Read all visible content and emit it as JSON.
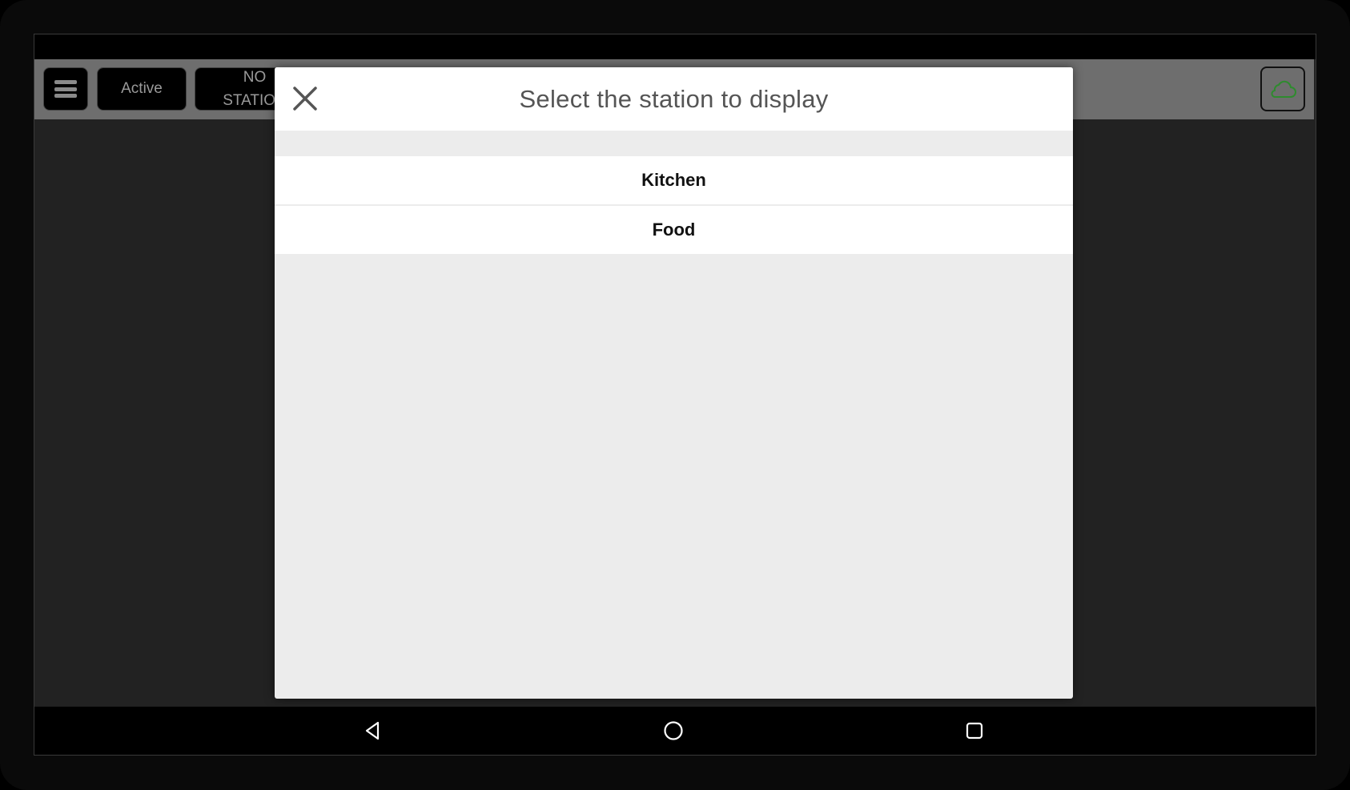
{
  "topbar": {
    "menu_icon": "hamburger-menu-icon",
    "active_label": "Active",
    "station_label_line1": "NO",
    "station_label_line2": "STATION",
    "cloud_icon": "cloud-icon",
    "cloud_color": "#2e8b2e"
  },
  "dialog": {
    "title": "Select the station to display",
    "close_icon": "close-icon",
    "stations": [
      {
        "label": "Kitchen"
      },
      {
        "label": "Food"
      }
    ]
  },
  "navbar": {
    "back_icon": "back-triangle-icon",
    "home_icon": "home-circle-icon",
    "recent_icon": "recent-apps-square-icon"
  }
}
